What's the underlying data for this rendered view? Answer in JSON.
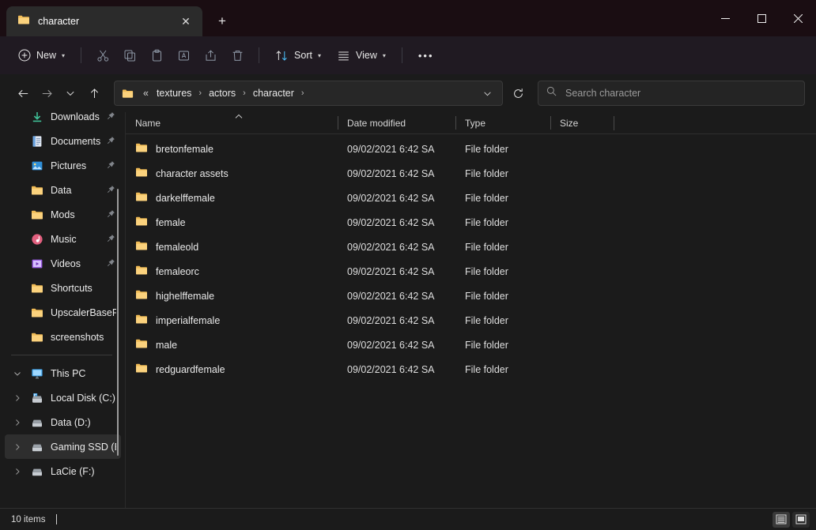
{
  "window": {
    "title": "character",
    "controls": {
      "minimize": "–",
      "maximize": "□",
      "close": "✕"
    }
  },
  "tabs": {
    "items": [
      {
        "label": "character",
        "icon": "folder-icon",
        "close": "✕"
      }
    ],
    "new_tab_label": "+"
  },
  "toolbar": {
    "new_label": "New",
    "sort_label": "Sort",
    "view_label": "View",
    "more_label": "•••",
    "items": [
      {
        "name": "cut",
        "icon": "scissors-icon"
      },
      {
        "name": "copy",
        "icon": "copy-icon"
      },
      {
        "name": "paste",
        "icon": "paste-icon"
      },
      {
        "name": "rename",
        "icon": "rename-icon"
      },
      {
        "name": "share",
        "icon": "share-icon"
      },
      {
        "name": "delete",
        "icon": "trash-icon"
      }
    ]
  },
  "navigation": {
    "back": "←",
    "forward": "→",
    "recent": "⌄",
    "up": "↑",
    "refresh": "⟳",
    "dropdown": "⌄"
  },
  "address": {
    "icon": "folder-icon",
    "ellipsis": "«",
    "crumbs": [
      "textures",
      "actors",
      "character"
    ],
    "separator": "›"
  },
  "search": {
    "placeholder": "Search character",
    "value": "",
    "icon": "search-icon"
  },
  "sidebar": {
    "quick_access": [
      {
        "label": "Downloads",
        "icon": "downloads-icon",
        "pinned": true
      },
      {
        "label": "Documents",
        "icon": "documents-icon",
        "pinned": true
      },
      {
        "label": "Pictures",
        "icon": "pictures-icon",
        "pinned": true
      },
      {
        "label": "Data",
        "icon": "folder-icon",
        "pinned": true
      },
      {
        "label": "Mods",
        "icon": "folder-icon",
        "pinned": true
      },
      {
        "label": "Music",
        "icon": "music-icon",
        "pinned": true
      },
      {
        "label": "Videos",
        "icon": "videos-icon",
        "pinned": true
      },
      {
        "label": "Shortcuts",
        "icon": "folder-icon",
        "pinned": false
      },
      {
        "label": "UpscalerBasePlu",
        "icon": "folder-icon",
        "pinned": false
      },
      {
        "label": "screenshots",
        "icon": "folder-icon",
        "pinned": false
      }
    ],
    "this_pc": {
      "label": "This PC",
      "icon": "monitor-icon",
      "expanded": true,
      "chevron": "⌄",
      "drives": [
        {
          "label": "Local Disk (C:)",
          "icon": "system-drive-icon",
          "chevron": "›",
          "selected": false
        },
        {
          "label": "Data (D:)",
          "icon": "drive-icon",
          "chevron": "›",
          "selected": false
        },
        {
          "label": "Gaming SSD (E",
          "icon": "drive-icon",
          "chevron": "›",
          "selected": true
        },
        {
          "label": "LaCie (F:)",
          "icon": "drive-icon",
          "chevron": "›",
          "selected": false
        }
      ]
    }
  },
  "file_list": {
    "columns": [
      {
        "label": "Name",
        "sorted": "asc",
        "sort_glyph": "⌃"
      },
      {
        "label": "Date modified",
        "sorted": ""
      },
      {
        "label": "Type",
        "sorted": ""
      },
      {
        "label": "Size",
        "sorted": ""
      }
    ],
    "rows": [
      {
        "name": "bretonfemale",
        "date": "09/02/2021 6:42 SA",
        "type": "File folder",
        "size": "",
        "icon": "folder-icon"
      },
      {
        "name": "character assets",
        "date": "09/02/2021 6:42 SA",
        "type": "File folder",
        "size": "",
        "icon": "folder-icon"
      },
      {
        "name": "darkelffemale",
        "date": "09/02/2021 6:42 SA",
        "type": "File folder",
        "size": "",
        "icon": "folder-icon"
      },
      {
        "name": "female",
        "date": "09/02/2021 6:42 SA",
        "type": "File folder",
        "size": "",
        "icon": "folder-icon"
      },
      {
        "name": "femaleold",
        "date": "09/02/2021 6:42 SA",
        "type": "File folder",
        "size": "",
        "icon": "folder-icon"
      },
      {
        "name": "femaleorc",
        "date": "09/02/2021 6:42 SA",
        "type": "File folder",
        "size": "",
        "icon": "folder-icon"
      },
      {
        "name": "highelffemale",
        "date": "09/02/2021 6:42 SA",
        "type": "File folder",
        "size": "",
        "icon": "folder-icon"
      },
      {
        "name": "imperialfemale",
        "date": "09/02/2021 6:42 SA",
        "type": "File folder",
        "size": "",
        "icon": "folder-icon"
      },
      {
        "name": "male",
        "date": "09/02/2021 6:42 SA",
        "type": "File folder",
        "size": "",
        "icon": "folder-icon"
      },
      {
        "name": "redguardfemale",
        "date": "09/02/2021 6:42 SA",
        "type": "File folder",
        "size": "",
        "icon": "folder-icon"
      }
    ]
  },
  "statusbar": {
    "item_count": "10 items",
    "view_details_icon": "details-view-icon",
    "view_tiles_icon": "large-icons-view-icon"
  },
  "colors": {
    "titlebar": "#1a0d12",
    "toolbar": "#201a22",
    "surface": "#1b1b1b",
    "tab_active": "#2b2b2b",
    "folder_yellow": "#f5c35c",
    "accent_blue": "#4cc2ff",
    "text_primary": "#e9e9e9",
    "selection": "#2e2e2e"
  }
}
